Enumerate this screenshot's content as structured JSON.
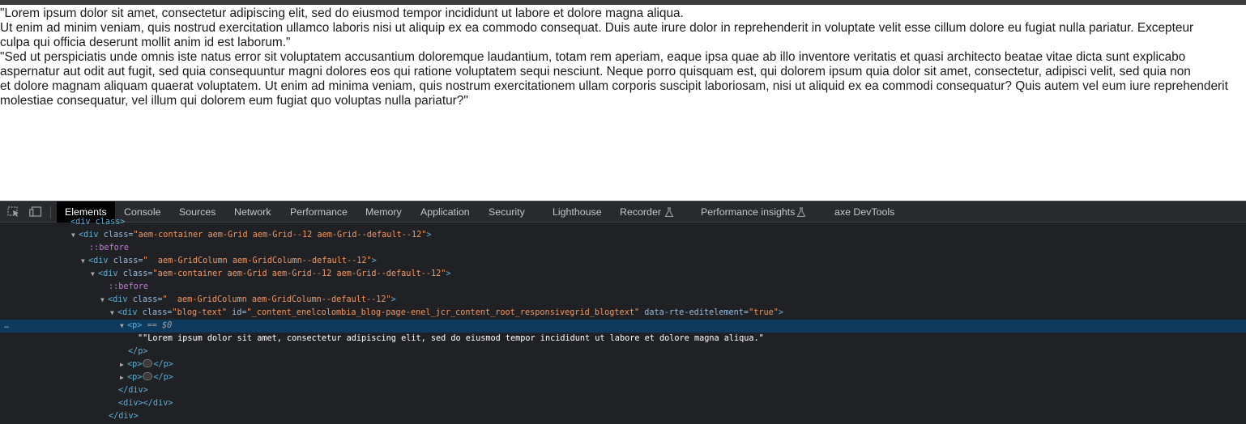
{
  "page": {
    "lines": [
      "\"Lorem ipsum dolor sit amet, consectetur adipiscing elit, sed do eiusmod tempor incididunt ut labore et dolore magna aliqua.",
      "Ut enim ad minim veniam, quis nostrud exercitation ullamco laboris nisi ut aliquip ex ea commodo consequat. Duis aute irure dolor in reprehenderit in voluptate velit esse cillum dolore eu fugiat nulla pariatur. Excepteur",
      "culpa qui officia deserunt mollit anim id est laborum.\"",
      "\"Sed ut perspiciatis unde omnis iste natus error sit voluptatem accusantium doloremque laudantium, totam rem aperiam, eaque ipsa quae ab illo inventore veritatis et quasi architecto beatae vitae dicta sunt explicabo",
      "aspernatur aut odit aut fugit, sed quia consequuntur magni dolores eos qui ratione voluptatem sequi nesciunt. Neque porro quisquam est, qui dolorem ipsum quia dolor sit amet, consectetur, adipisci velit, sed quia non",
      "et dolore magnam aliquam quaerat voluptatem. Ut enim ad minima veniam, quis nostrum exercitationem ullam corporis suscipit laboriosam, nisi ut aliquid ex ea commodi consequatur? Quis autem vel eum iure reprehenderit",
      "molestiae consequatur, vel illum qui dolorem eum fugiat quo voluptas nulla pariatur?\""
    ]
  },
  "devtools": {
    "toolbar_icons": [
      "inspect-element-icon",
      "device-toolbar-icon",
      "flask-icon"
    ],
    "tabs": {
      "elements": "Elements",
      "console": "Console",
      "sources": "Sources",
      "network": "Network",
      "performance": "Performance",
      "memory": "Memory",
      "application": "Application",
      "security": "Security",
      "lighthouse": "Lighthouse",
      "recorder": "Recorder",
      "performance_insights": "Performance insights",
      "axe": "axe DevTools"
    },
    "tree": {
      "row0": {
        "text": "<div class>"
      },
      "row1": {
        "tag": "div",
        "attr": "class",
        "value": "aem-container aem-Grid aem-Grid--12 aem-Grid--default--12"
      },
      "row2": {
        "pseudo": "::before"
      },
      "row3": {
        "tag": "div",
        "attr": "class",
        "value": "  aem-GridColumn aem-GridColumn--default--12"
      },
      "row4": {
        "tag": "div",
        "attr": "class",
        "value": "aem-container aem-Grid aem-Grid--12 aem-Grid--default--12"
      },
      "row5": {
        "pseudo": "::before"
      },
      "row6": {
        "tag": "div",
        "attr": "class",
        "value": "  aem-GridColumn aem-GridColumn--default--12"
      },
      "row7": {
        "tag": "div",
        "attr1": "class",
        "value1": "blog-text",
        "attr2": "id",
        "value2": "_content_enelcolombia_blog-page-enel_jcr_content_root_responsivegrid_blogtext",
        "attr3": "data-rte-editelement",
        "value3": "true"
      },
      "row8": {
        "tag": "p",
        "eq": "==",
        "ref": "$0",
        "gutter": "…"
      },
      "row9": {
        "text": "\"\"Lorem ipsum dolor sit amet, consectetur adipiscing elit, sed do eiusmod tempor incididunt ut labore et dolore magna aliqua.\""
      },
      "row10": {
        "close": "</p>"
      },
      "row11": {
        "open": "<p>",
        "close": "</p>"
      },
      "row12": {
        "open": "<p>",
        "close": "</p>"
      },
      "row13": {
        "close": "</div>"
      },
      "row14": {
        "text": "<div></div>"
      },
      "row15": {
        "close": "</div>"
      }
    },
    "colors": {
      "panel_bg": "#202124",
      "selected_row": "#0e3a5d",
      "tag": "#5db0d7",
      "attr_name": "#9bbbdc",
      "attr_value": "#f29766",
      "pseudo": "#c679dd"
    }
  }
}
